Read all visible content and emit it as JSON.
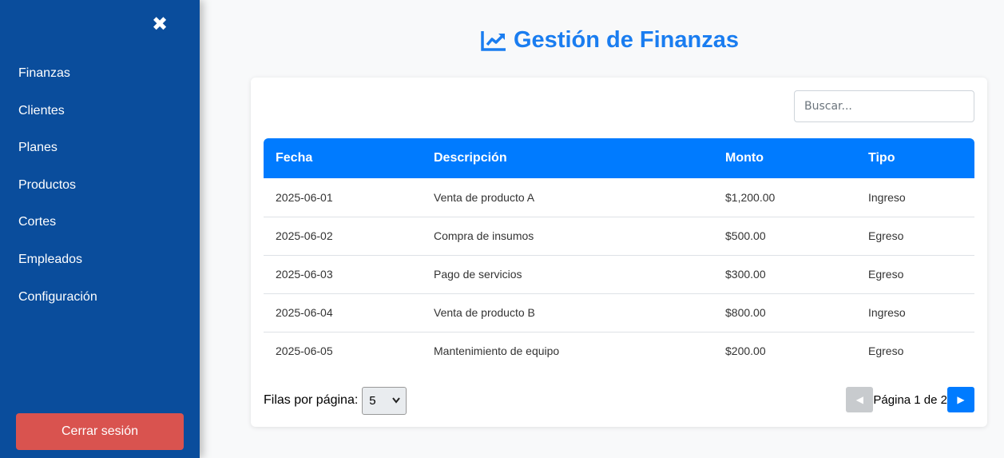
{
  "sidebar": {
    "close_glyph": "✖",
    "items": [
      {
        "label": "Finanzas"
      },
      {
        "label": "Clientes"
      },
      {
        "label": "Planes"
      },
      {
        "label": "Productos"
      },
      {
        "label": "Cortes"
      },
      {
        "label": "Empleados"
      },
      {
        "label": "Configuración"
      }
    ],
    "logout_label": "Cerrar sesión"
  },
  "header": {
    "title": "Gestión de Finanzas",
    "icon": "chart-line-icon"
  },
  "search": {
    "placeholder": "Buscar...",
    "value": ""
  },
  "table": {
    "columns": [
      "Fecha",
      "Descripción",
      "Monto",
      "Tipo"
    ],
    "rows": [
      [
        "2025-06-01",
        "Venta de producto A",
        "$1,200.00",
        "Ingreso"
      ],
      [
        "2025-06-02",
        "Compra de insumos",
        "$500.00",
        "Egreso"
      ],
      [
        "2025-06-03",
        "Pago de servicios",
        "$300.00",
        "Egreso"
      ],
      [
        "2025-06-04",
        "Venta de producto B",
        "$800.00",
        "Ingreso"
      ],
      [
        "2025-06-05",
        "Mantenimiento de equipo",
        "$200.00",
        "Egreso"
      ]
    ]
  },
  "pagination": {
    "rows_label": "Filas por página:",
    "rows_selected": "5",
    "prev_glyph": "◀",
    "next_glyph": "▶",
    "page_info": "Página 1 de 2"
  },
  "colors": {
    "sidebar_bg": "#0a4d9c",
    "accent": "#007bff",
    "title": "#1a7df0",
    "logout": "#d9534f"
  }
}
